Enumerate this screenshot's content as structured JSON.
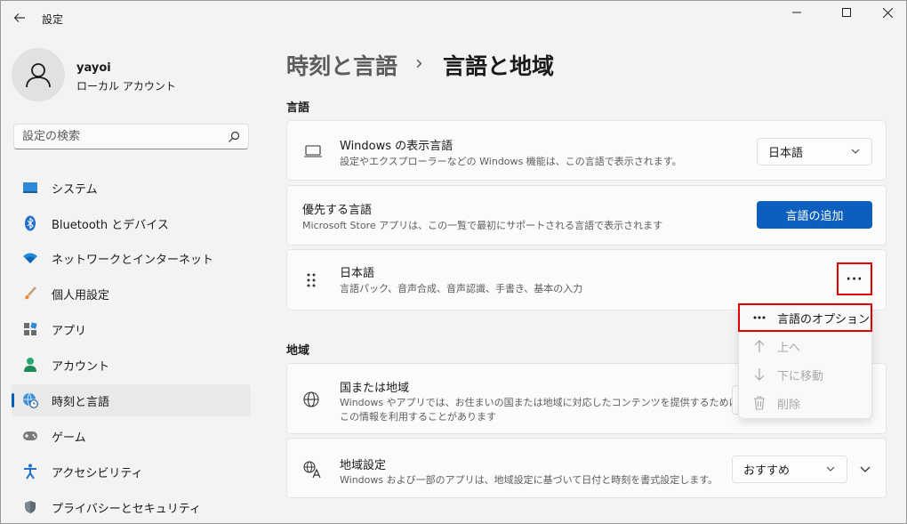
{
  "window": {
    "title": "設定"
  },
  "profile": {
    "name": "yayoi",
    "account_type": "ローカル アカウント"
  },
  "search": {
    "placeholder": "設定の検索"
  },
  "sidebar": {
    "items": [
      {
        "label": "システム",
        "icon": "monitor-icon"
      },
      {
        "label": "Bluetooth とデバイス",
        "icon": "bluetooth-icon"
      },
      {
        "label": "ネットワークとインターネット",
        "icon": "wifi-icon"
      },
      {
        "label": "個人用設定",
        "icon": "brush-icon"
      },
      {
        "label": "アプリ",
        "icon": "apps-icon"
      },
      {
        "label": "アカウント",
        "icon": "person-icon"
      },
      {
        "label": "時刻と言語",
        "icon": "globe-clock-icon",
        "selected": true
      },
      {
        "label": "ゲーム",
        "icon": "gamepad-icon"
      },
      {
        "label": "アクセシビリティ",
        "icon": "accessibility-icon"
      },
      {
        "label": "プライバシーとセキュリティ",
        "icon": "shield-icon"
      }
    ]
  },
  "breadcrumb": {
    "parent": "時刻と言語",
    "separator": "›",
    "current": "言語と地域"
  },
  "language_section": {
    "heading": "言語",
    "display_language": {
      "title": "Windows の表示言語",
      "description": "設定やエクスプローラーなどの Windows 機能は、この言語で表示されます。",
      "value": "日本語"
    },
    "preferred": {
      "title": "優先する言語",
      "description": "Microsoft Store アプリは、この一覧で最初にサポートされる言語で表示されます",
      "add_button": "言語の追加"
    },
    "japanese": {
      "title": "日本語",
      "description": "言語パック、音声合成、音声認識、手書き、基本の入力",
      "more_button": "···"
    }
  },
  "context_menu": {
    "items": [
      {
        "label": "言語のオプション",
        "icon": "more-icon",
        "enabled": true
      },
      {
        "label": "上へ",
        "icon": "arrow-up-icon",
        "enabled": false
      },
      {
        "label": "下に移動",
        "icon": "arrow-down-icon",
        "enabled": false
      },
      {
        "label": "削除",
        "icon": "trash-icon",
        "enabled": false
      }
    ]
  },
  "region_section": {
    "heading": "地域",
    "country": {
      "title": "国または地域",
      "description_line1": "Windows やアプリでは、お住まいの国または地域に対応したコンテンツを提供するために、",
      "description_line2": "この情報を利用することがあります"
    },
    "regional_format": {
      "title": "地域設定",
      "description": "Windows および一部のアプリは、地域設定に基づいて日付と時刻を書式設定します。",
      "value": "おすすめ"
    }
  },
  "colors": {
    "accent": "#0c5fbd",
    "highlight_border": "#e00000"
  }
}
